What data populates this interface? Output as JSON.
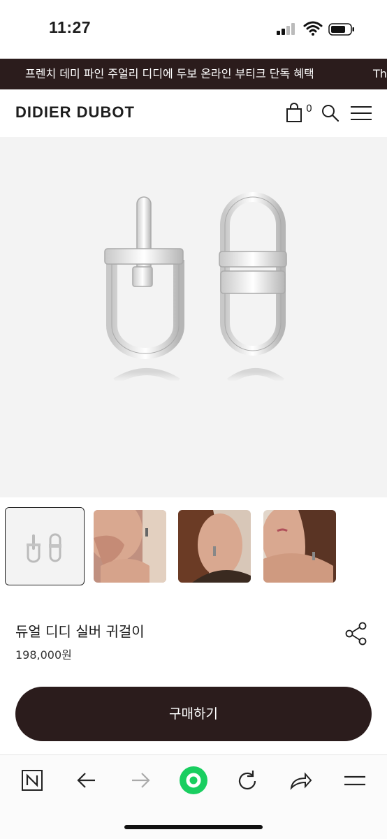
{
  "status_bar": {
    "time": "11:27"
  },
  "promo": {
    "text": "프렌치 데미 파인 주얼리 디디에 두보 온라인 부티크 단독 혜택",
    "text_cont": "Th"
  },
  "header": {
    "brand": "DIDIER DUBOT",
    "cart_count": "0"
  },
  "product": {
    "name": "듀얼 디디 실버 귀걸이",
    "price": "198,000원"
  },
  "thumbnails": [
    {
      "label": "product-shot",
      "selected": true
    },
    {
      "label": "model-shot-1",
      "selected": false
    },
    {
      "label": "model-shot-2",
      "selected": false
    },
    {
      "label": "model-shot-3",
      "selected": false
    }
  ],
  "buy_button": {
    "label": "구매하기"
  },
  "browser_toolbar": {
    "items": [
      "naver-n-icon",
      "back-arrow-icon",
      "forward-arrow-icon",
      "green-home-icon",
      "reload-icon",
      "share-icon",
      "menu-icon"
    ],
    "accent_color": "#19ce60"
  },
  "colors": {
    "brand_dark": "#2b1c1c"
  }
}
